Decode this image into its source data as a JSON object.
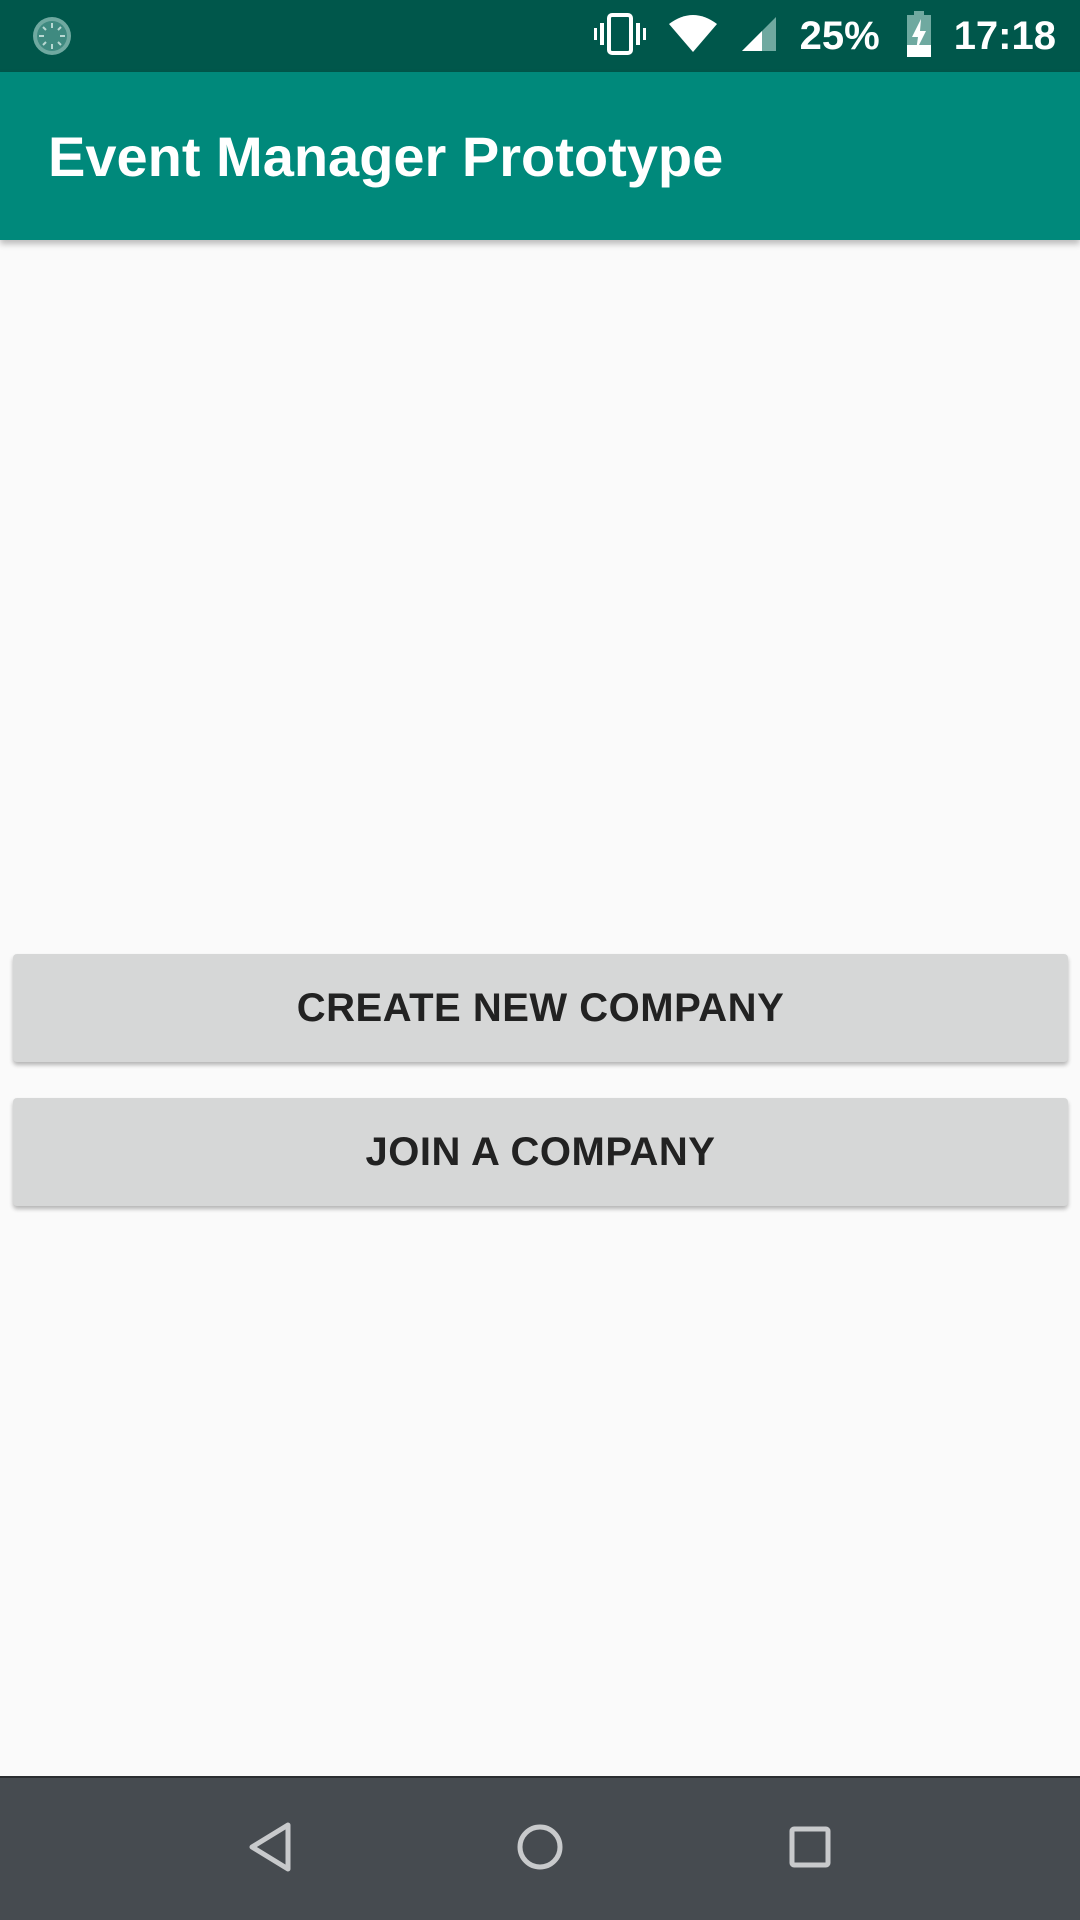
{
  "status_bar": {
    "notification_icon": "sync-circle-icon",
    "icons": [
      "vibrate-icon",
      "wifi-icon",
      "cell-signal-icon",
      "battery-charging-icon"
    ],
    "battery_percent": "25%",
    "time": "17:18"
  },
  "app_bar": {
    "title": "Event Manager Prototype",
    "color": "#00897b",
    "status_color": "#00574b"
  },
  "main": {
    "buttons": [
      {
        "label": "CREATE NEW COMPANY"
      },
      {
        "label": "JOIN A COMPANY"
      }
    ]
  },
  "nav_bar": {
    "items": [
      "back-icon",
      "home-icon",
      "recents-icon"
    ]
  }
}
